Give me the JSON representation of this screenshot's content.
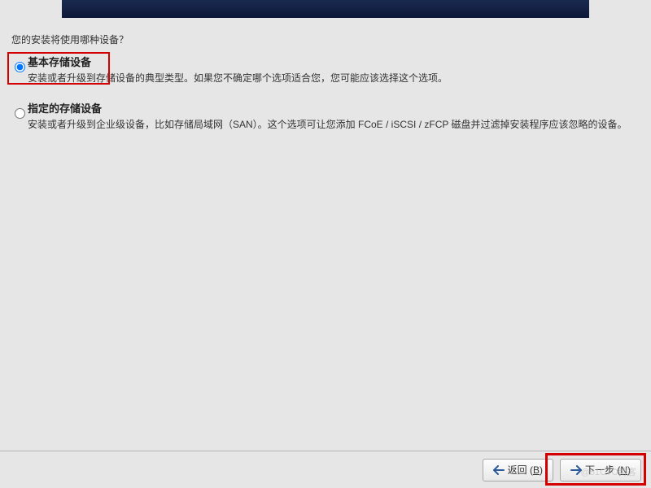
{
  "question": "您的安装将使用哪种设备？",
  "options": [
    {
      "title": "基本存储设备",
      "desc": "安装或者升级到存储设备的典型类型。如果您不确定哪个选项适合您，您可能应该选择这个选项。",
      "selected": true
    },
    {
      "title": "指定的存储设备",
      "desc": "安装或者升级到企业级设备，比如存储局域网（SAN）。这个选项可让您添加 FCoE / iSCSI / zFCP 磁盘并过滤掉安装程序应该忽略的设备。",
      "selected": false
    }
  ],
  "buttons": {
    "back": "返回",
    "back_key": "B",
    "next": "下一步",
    "next_key": "N"
  },
  "watermark": "@51CTO博客"
}
